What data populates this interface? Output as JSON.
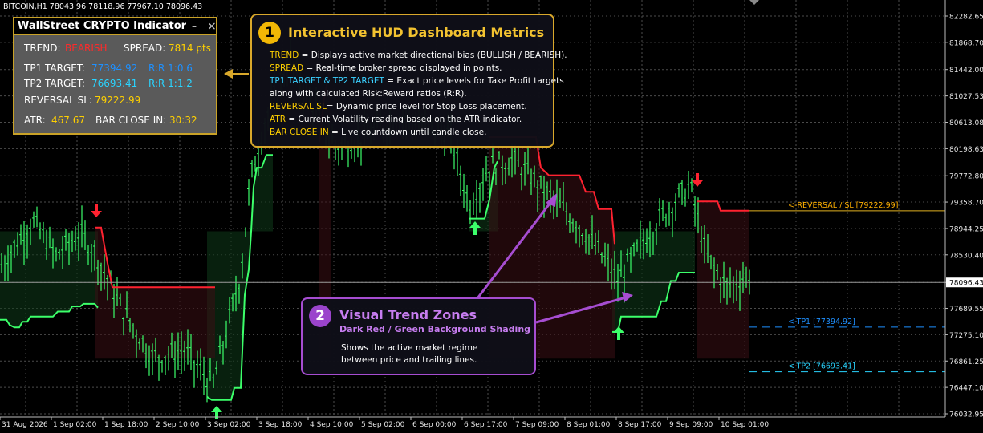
{
  "header": {
    "symbol_line": "BITCOIN,H1  78043.96 78118.96 77967.10 78096.43"
  },
  "axis": {
    "price_ticks": [
      "82282.65",
      "81868.70",
      "81442.00",
      "81027.53",
      "80613.08",
      "80198.63",
      "79772.80",
      "79358.70",
      "78944.25",
      "78530.40",
      "78096.43",
      "77689.55",
      "77275.10",
      "76861.25",
      "76447.10",
      "76032.95"
    ],
    "time_ticks": [
      "31 Aug 2026",
      "1 Sep 02:00",
      "1 Sep 18:00",
      "2 Sep 10:00",
      "3 Sep 02:00",
      "3 Sep 18:00",
      "4 Sep 10:00",
      "5 Sep 02:00",
      "6 Sep 00:00",
      "6 Sep 17:00",
      "7 Sep 09:00",
      "8 Sep 01:00",
      "8 Sep 17:00",
      "9 Sep 09:00",
      "10 Sep 01:00"
    ]
  },
  "hud": {
    "title": "WallStreet CRYPTO Indicator",
    "minimize": "–",
    "close": "×",
    "trend_label": "TREND:",
    "trend_value": "BEARISH",
    "spread_label": "SPREAD:",
    "spread_value": "7814 pts",
    "tp1_label": "TP1 TARGET:",
    "tp1_value": "77394.92",
    "tp1_rr": "R:R 1:0.6",
    "tp2_label": "TP2 TARGET:",
    "tp2_value": "76693.41",
    "tp2_rr": "R:R 1:1.2",
    "sl_label": "REVERSAL SL:",
    "sl_value": "79222.99",
    "atr_label": "ATR:",
    "atr_value": "467.67",
    "bar_close_label": "BAR CLOSE IN:",
    "bar_close_value": "30:32"
  },
  "callout1": {
    "badge": "1",
    "title": "Interactive HUD Dashboard Metrics",
    "lines": [
      {
        "kw": "TREND",
        "text": " = Displays active market directional bias (BULLISH / BEARISH)."
      },
      {
        "kw": "SPREAD",
        "text": " = Real-time broker spread displayed in points."
      },
      {
        "kw": "TP1 TARGET & TP2 TARGET",
        "text": " = Exact price levels for Take Profit targets"
      },
      {
        "kw": "",
        "text": "along with calculated Risk:Reward ratios (R:R)."
      },
      {
        "kw": "REVERSAL SL",
        "text": "= Dynamic price level for Stop Loss placement."
      },
      {
        "kw": "ATR",
        "text": " = Current Volatility reading based on the ATR indicator."
      },
      {
        "kw": "BAR CLOSE IN",
        "text": " = Live countdown until candle close."
      }
    ]
  },
  "callout2": {
    "badge": "2",
    "title": "Visual Trend Zones",
    "subtitle": "Dark Red / Green Background Shading",
    "line1": "Shows the active market regime",
    "line2": "between price and trailing lines."
  },
  "levels": {
    "reversal": "<-REVERSAL / SL [79222.99]",
    "tp1": "<-TP1 [77394.92]",
    "tp2": "<-TP2 [76693.41]",
    "current_price": "78096.43"
  },
  "colors": {
    "bull": "#3cff6a",
    "bear": "#ff2230",
    "gold": "#d9a82b",
    "purple": "#a64dd1",
    "tp_line": "#1e90ff"
  }
}
